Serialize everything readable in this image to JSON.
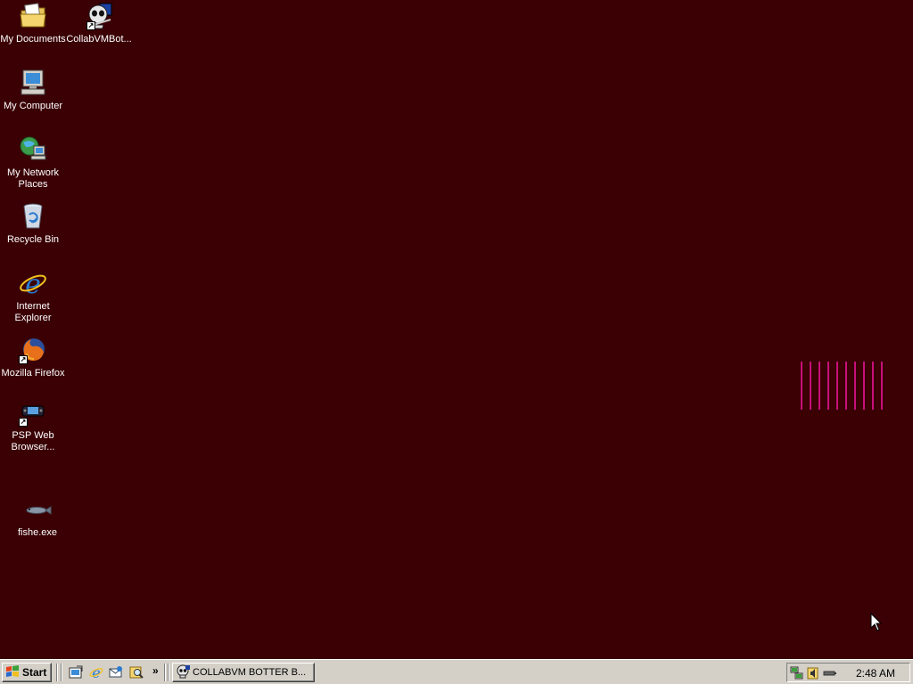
{
  "desktop": {
    "background_color": "#3a0004",
    "icons": [
      {
        "label": "My Documents",
        "icon": "my-documents-icon"
      },
      {
        "label": "CollabVMBot...",
        "icon": "skull-bot-icon"
      },
      {
        "label": "My Computer",
        "icon": "my-computer-icon"
      },
      {
        "label": "My Network Places",
        "icon": "network-places-icon"
      },
      {
        "label": "Recycle Bin",
        "icon": "recycle-bin-icon"
      },
      {
        "label": "Internet Explorer",
        "icon": "internet-explorer-icon"
      },
      {
        "label": "Mozilla Firefox",
        "icon": "firefox-icon"
      },
      {
        "label": "PSP Web Browser...",
        "icon": "psp-icon"
      },
      {
        "label": "fishe.exe",
        "icon": "fish-icon"
      }
    ],
    "stripe_color": "#c8107a"
  },
  "taskbar": {
    "start_label": "Start",
    "quick_launch": [
      "show-desktop-icon",
      "internet-explorer-icon",
      "outlook-express-icon",
      "search-icon"
    ],
    "task_button_label": "COLLABVM BOTTER B...",
    "tray_icons": [
      "network-icon",
      "volume-icon",
      "battery-icon"
    ],
    "clock": "2:48 AM"
  }
}
